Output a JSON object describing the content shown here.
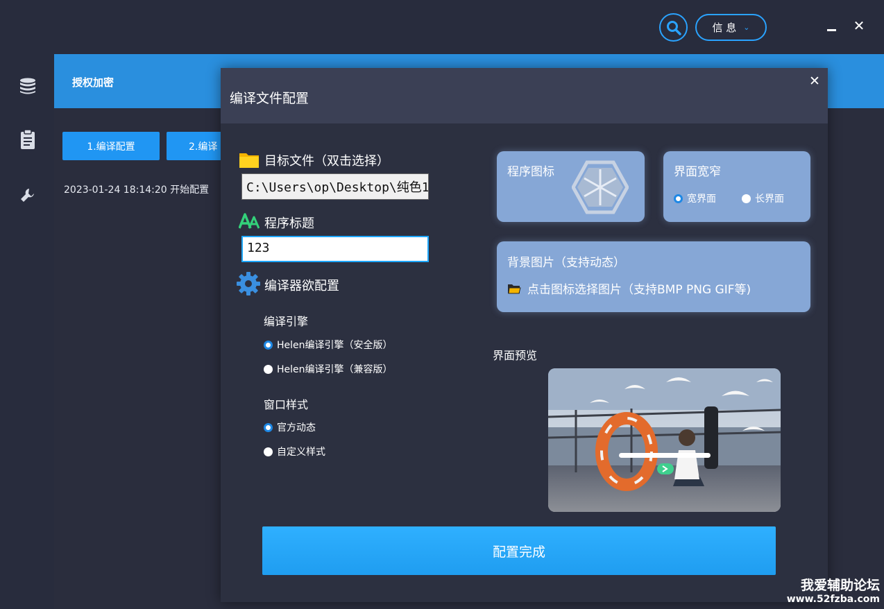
{
  "topbar": {
    "info_label": "信 息",
    "colors": {
      "accent": "#2aa3ff",
      "background": "#282c3d"
    },
    "icons": [
      "search-icon",
      "chevron-down-icon",
      "minimize-icon",
      "close-icon"
    ]
  },
  "rail": {
    "icons": [
      "database-icon",
      "clipboard-icon",
      "wrench-icon"
    ]
  },
  "main": {
    "title": "授权加密",
    "steps": [
      "1.编译配置",
      "2.编译"
    ],
    "log_line": "2023-01-24 18:14:20 开始配置",
    "colors": {
      "header": "#2a8fde",
      "step_button": "#2096f3"
    }
  },
  "dialog": {
    "title": "编译文件配置",
    "target_file": {
      "label": "目标文件（双击选择）",
      "value": "C:\\Users\\op\\Desktop\\纯色1"
    },
    "program_title": {
      "label": "程序标题",
      "value": "123"
    },
    "compiler_config": {
      "label": "编译器欲配置",
      "engine": {
        "label": "编译引擎",
        "options": [
          {
            "label": "Helen编译引擎（安全版）",
            "selected": true
          },
          {
            "label": "Helen编译引擎（兼容版）",
            "selected": false
          }
        ]
      },
      "window_style": {
        "label": "窗口样式",
        "options": [
          {
            "label": "官方动态",
            "selected": true
          },
          {
            "label": "自定义样式",
            "selected": false
          }
        ]
      }
    },
    "program_icon": {
      "label": "程序图标"
    },
    "ui_width": {
      "label": "界面宽窄",
      "options": [
        {
          "label": "宽界面",
          "selected": true
        },
        {
          "label": "长界面",
          "selected": false
        }
      ]
    },
    "background": {
      "label": "背景图片（支持动态）",
      "hint": "点击图标选择图片（支持BMP PNG GIF等)"
    },
    "preview": {
      "label": "界面预览"
    },
    "done_button": "配置完成",
    "colors": {
      "card": "#86a7d6",
      "done_button": "#26a6f8",
      "title_input_border": "#1ea7ff"
    }
  },
  "watermark": {
    "line1": "我爱辅助论坛",
    "line2": "www.52fzba.com"
  }
}
